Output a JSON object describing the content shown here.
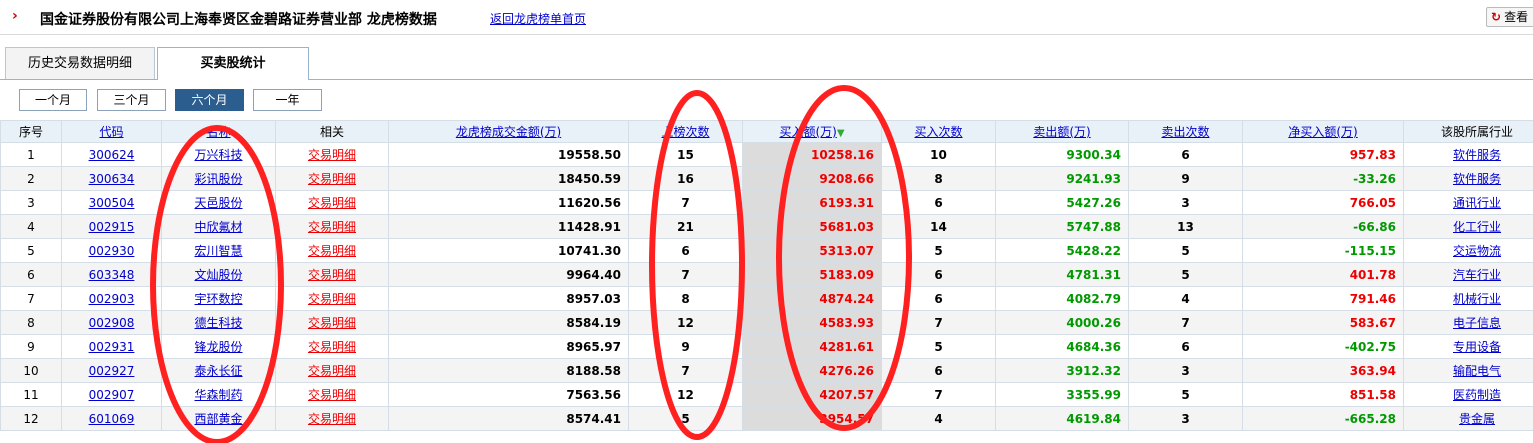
{
  "header": {
    "title": "国金证券股份有限公司上海奉贤区金碧路证券营业部 龙虎榜数据",
    "back_link": "返回龙虎榜单首页",
    "view_button": "查看"
  },
  "tabs": [
    {
      "label": "历史交易数据明细",
      "active": false
    },
    {
      "label": "买卖股统计",
      "active": true
    }
  ],
  "periods": [
    {
      "label": "一个月",
      "active": false
    },
    {
      "label": "三个月",
      "active": false
    },
    {
      "label": "六个月",
      "active": true
    },
    {
      "label": "一年",
      "active": false
    }
  ],
  "table": {
    "columns": [
      "序号",
      "代码",
      "名称",
      "相关",
      "龙虎榜成交金额(万)",
      "上榜次数",
      "买入额(万)",
      "买入次数",
      "卖出额(万)",
      "卖出次数",
      "净买入额(万)",
      "该股所属行业"
    ],
    "sort_column": "买入额(万)",
    "rows": [
      {
        "no": "1",
        "code": "300624",
        "name": "万兴科技",
        "rel": "交易明细",
        "amount": "19558.50",
        "times": "15",
        "buy": "10258.16",
        "buy_times": "10",
        "sell": "9300.34",
        "sell_times": "6",
        "net": "957.83",
        "industry": "软件服务"
      },
      {
        "no": "2",
        "code": "300634",
        "name": "彩讯股份",
        "rel": "交易明细",
        "amount": "18450.59",
        "times": "16",
        "buy": "9208.66",
        "buy_times": "8",
        "sell": "9241.93",
        "sell_times": "9",
        "net": "-33.26",
        "industry": "软件服务"
      },
      {
        "no": "3",
        "code": "300504",
        "name": "天邑股份",
        "rel": "交易明细",
        "amount": "11620.56",
        "times": "7",
        "buy": "6193.31",
        "buy_times": "6",
        "sell": "5427.26",
        "sell_times": "3",
        "net": "766.05",
        "industry": "通讯行业"
      },
      {
        "no": "4",
        "code": "002915",
        "name": "中欣氟材",
        "rel": "交易明细",
        "amount": "11428.91",
        "times": "21",
        "buy": "5681.03",
        "buy_times": "14",
        "sell": "5747.88",
        "sell_times": "13",
        "net": "-66.86",
        "industry": "化工行业"
      },
      {
        "no": "5",
        "code": "002930",
        "name": "宏川智慧",
        "rel": "交易明细",
        "amount": "10741.30",
        "times": "6",
        "buy": "5313.07",
        "buy_times": "5",
        "sell": "5428.22",
        "sell_times": "5",
        "net": "-115.15",
        "industry": "交运物流"
      },
      {
        "no": "6",
        "code": "603348",
        "name": "文灿股份",
        "rel": "交易明细",
        "amount": "9964.40",
        "times": "7",
        "buy": "5183.09",
        "buy_times": "6",
        "sell": "4781.31",
        "sell_times": "5",
        "net": "401.78",
        "industry": "汽车行业"
      },
      {
        "no": "7",
        "code": "002903",
        "name": "宇环数控",
        "rel": "交易明细",
        "amount": "8957.03",
        "times": "8",
        "buy": "4874.24",
        "buy_times": "6",
        "sell": "4082.79",
        "sell_times": "4",
        "net": "791.46",
        "industry": "机械行业"
      },
      {
        "no": "8",
        "code": "002908",
        "name": "德生科技",
        "rel": "交易明细",
        "amount": "8584.19",
        "times": "12",
        "buy": "4583.93",
        "buy_times": "7",
        "sell": "4000.26",
        "sell_times": "7",
        "net": "583.67",
        "industry": "电子信息"
      },
      {
        "no": "9",
        "code": "002931",
        "name": "锋龙股份",
        "rel": "交易明细",
        "amount": "8965.97",
        "times": "9",
        "buy": "4281.61",
        "buy_times": "5",
        "sell": "4684.36",
        "sell_times": "6",
        "net": "-402.75",
        "industry": "专用设备"
      },
      {
        "no": "10",
        "code": "002927",
        "name": "泰永长征",
        "rel": "交易明细",
        "amount": "8188.58",
        "times": "7",
        "buy": "4276.26",
        "buy_times": "6",
        "sell": "3912.32",
        "sell_times": "3",
        "net": "363.94",
        "industry": "输配电气"
      },
      {
        "no": "11",
        "code": "002907",
        "name": "华森制药",
        "rel": "交易明细",
        "amount": "7563.56",
        "times": "12",
        "buy": "4207.57",
        "buy_times": "7",
        "sell": "3355.99",
        "sell_times": "5",
        "net": "851.58",
        "industry": "医药制造"
      },
      {
        "no": "12",
        "code": "601069",
        "name": "西部黄金",
        "rel": "交易明细",
        "amount": "8574.41",
        "times": "5",
        "buy": "3954.57",
        "buy_times": "4",
        "sell": "4619.84",
        "sell_times": "3",
        "net": "-665.28",
        "industry": "贵金属"
      }
    ]
  },
  "colors": {
    "positive": "#e00000",
    "negative": "#009900",
    "link": "#0000cc",
    "annotation": "#ff2020",
    "header_bg": "#e8f0f8"
  }
}
